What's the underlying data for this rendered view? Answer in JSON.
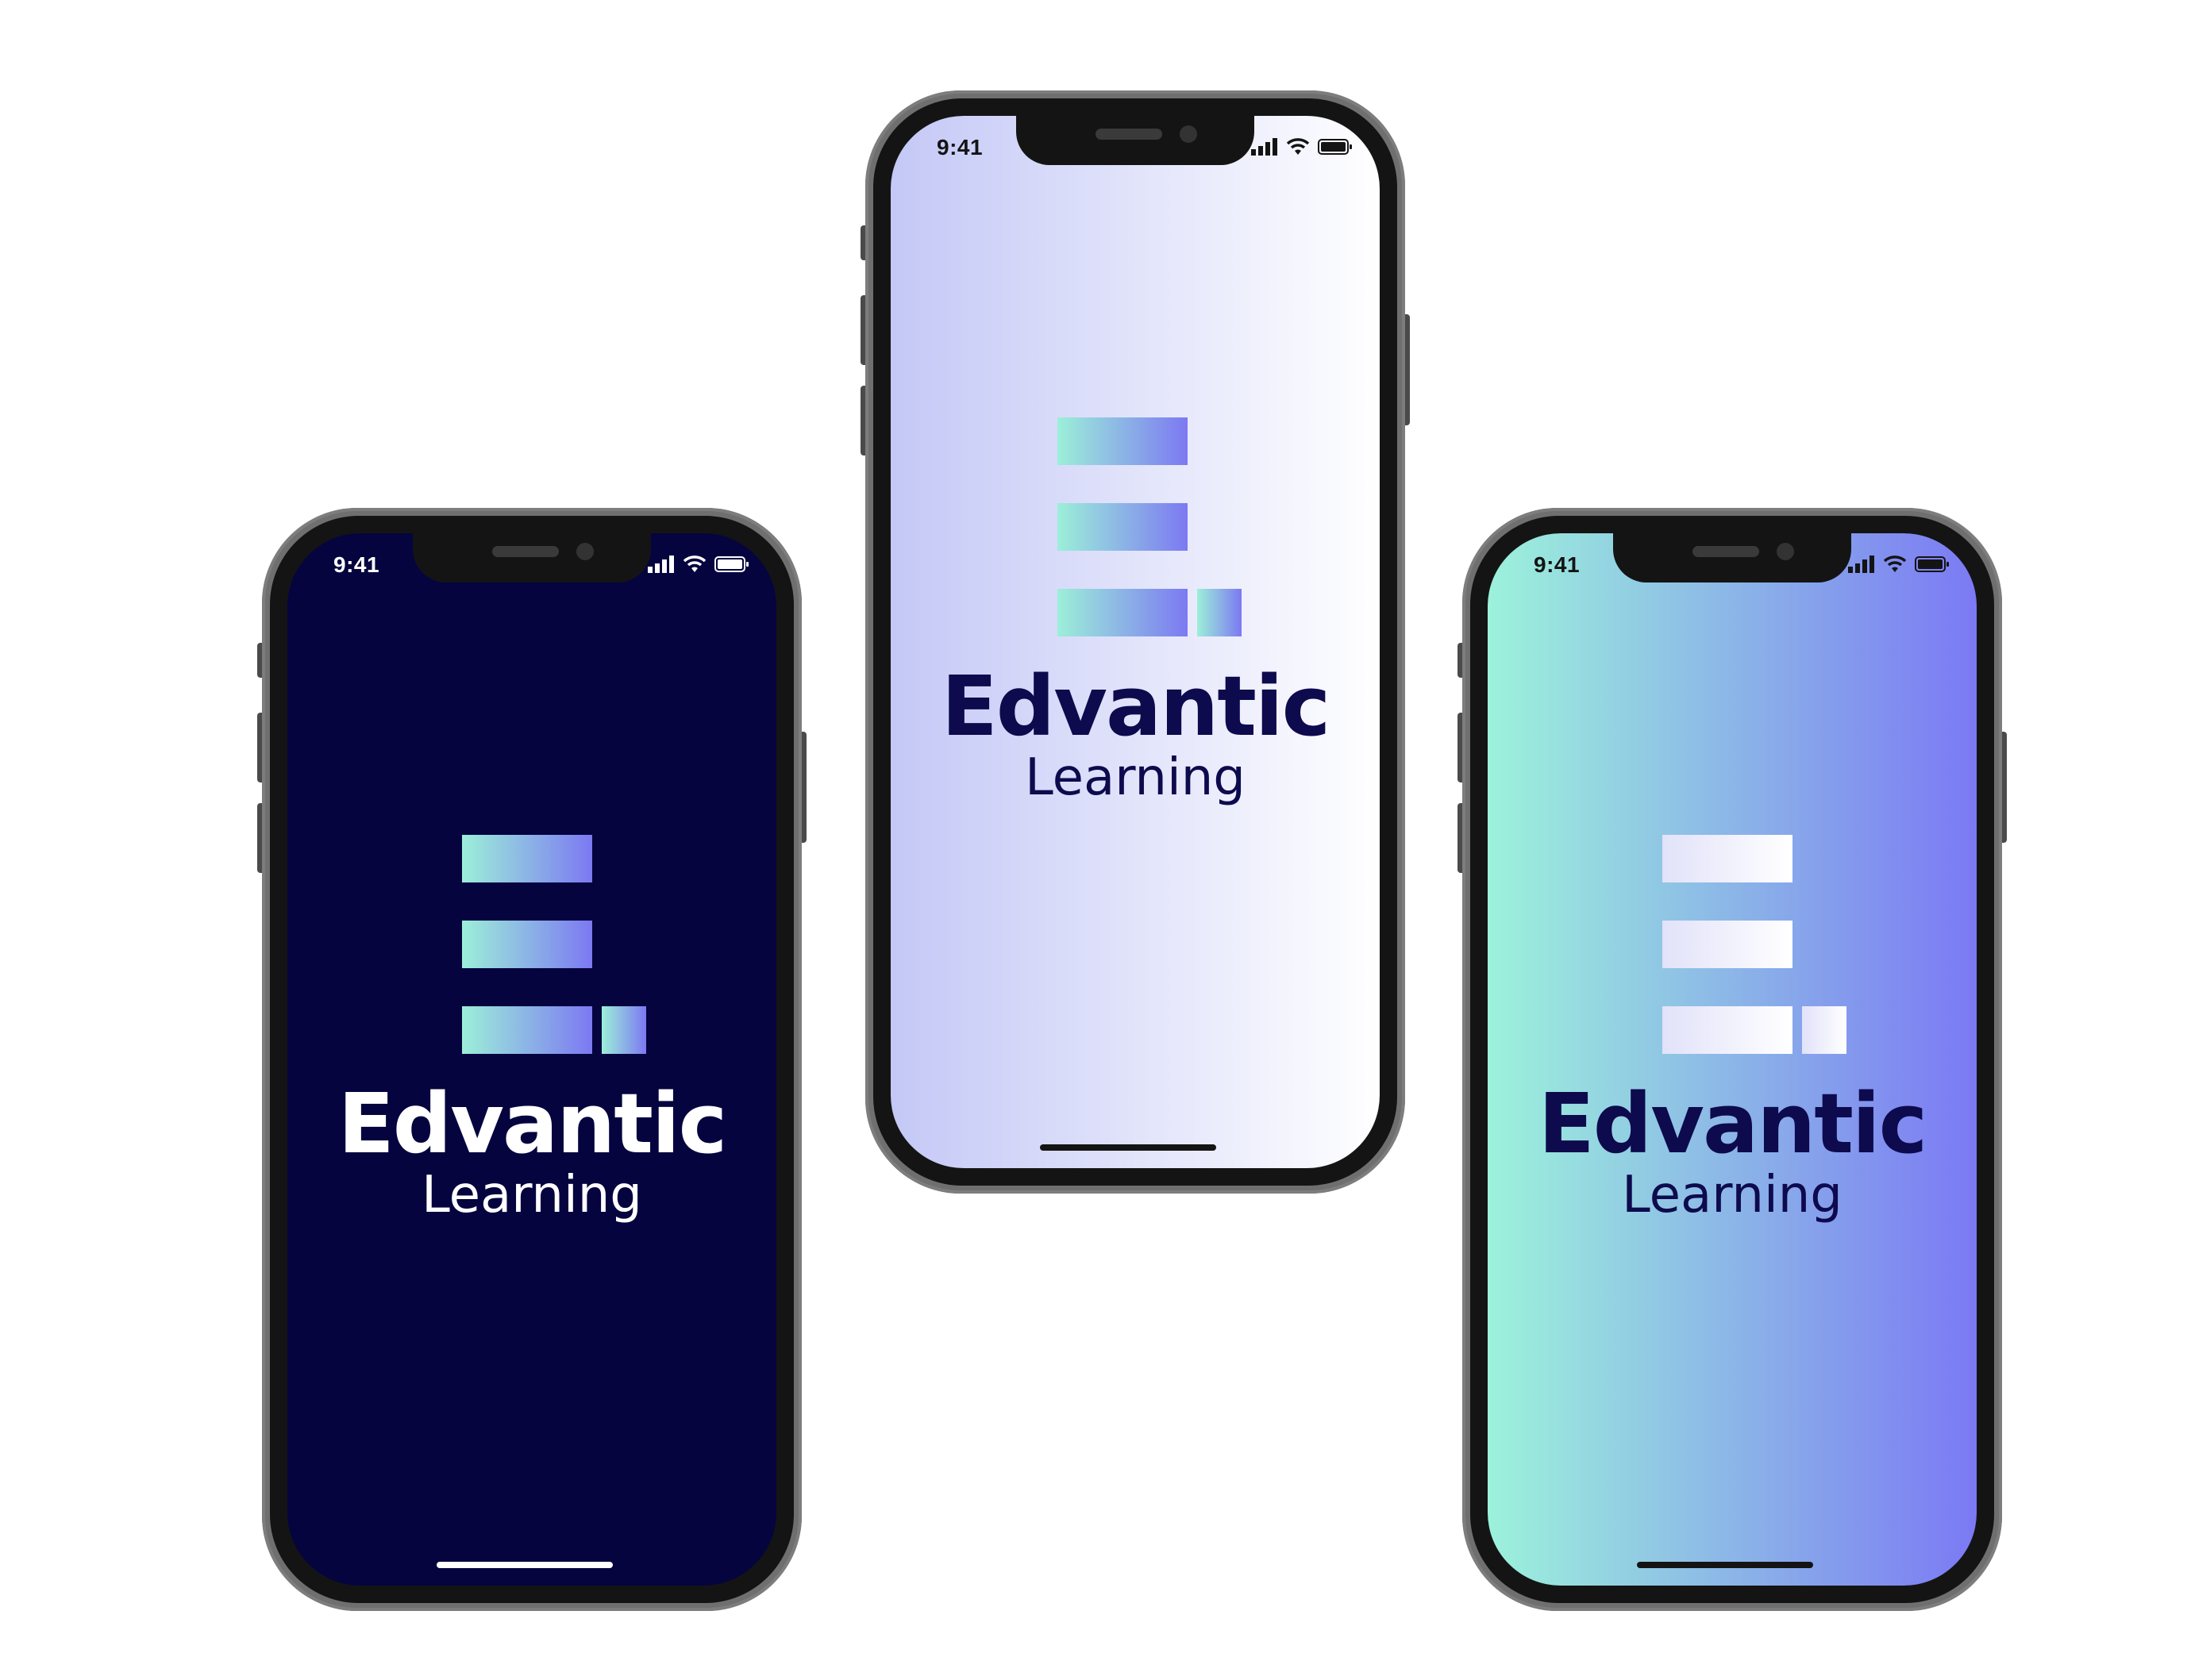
{
  "phones": [
    {
      "theme": "dark-navy",
      "status_time": "9:41",
      "brand_name": "Edvantic",
      "brand_sub": "Learning",
      "colors": {
        "background": "#05043f",
        "text": "#ffffff",
        "status": "#ffffff",
        "home_indicator": "#ffffff",
        "logo_gradient": [
          "#9cefd9",
          "#7c79f2"
        ]
      },
      "icons": [
        "signal-icon",
        "wifi-icon",
        "battery-icon"
      ]
    },
    {
      "theme": "lavender",
      "status_time": "9:41",
      "brand_name": "Edvantic",
      "brand_sub": "Learning",
      "colors": {
        "background_gradient": [
          "#c4c8f6",
          "#ffffff"
        ],
        "text": "#0d0a4d",
        "status": "#141414",
        "home_indicator": "#141414",
        "logo_gradient": [
          "#9cefd9",
          "#7c79f2"
        ]
      },
      "icons": [
        "signal-icon",
        "wifi-icon",
        "battery-icon"
      ]
    },
    {
      "theme": "mint-violet",
      "status_time": "9:41",
      "brand_name": "Edvantic",
      "brand_sub": "Learning",
      "colors": {
        "background_gradient": [
          "#9cf2db",
          "#7b79f4"
        ],
        "text": "#0d0a4d",
        "status": "#141414",
        "home_indicator": "#141414",
        "logo_gradient": [
          "#e2e2fa",
          "#ffffff"
        ]
      },
      "icons": [
        "signal-icon",
        "wifi-icon",
        "battery-icon"
      ]
    }
  ]
}
